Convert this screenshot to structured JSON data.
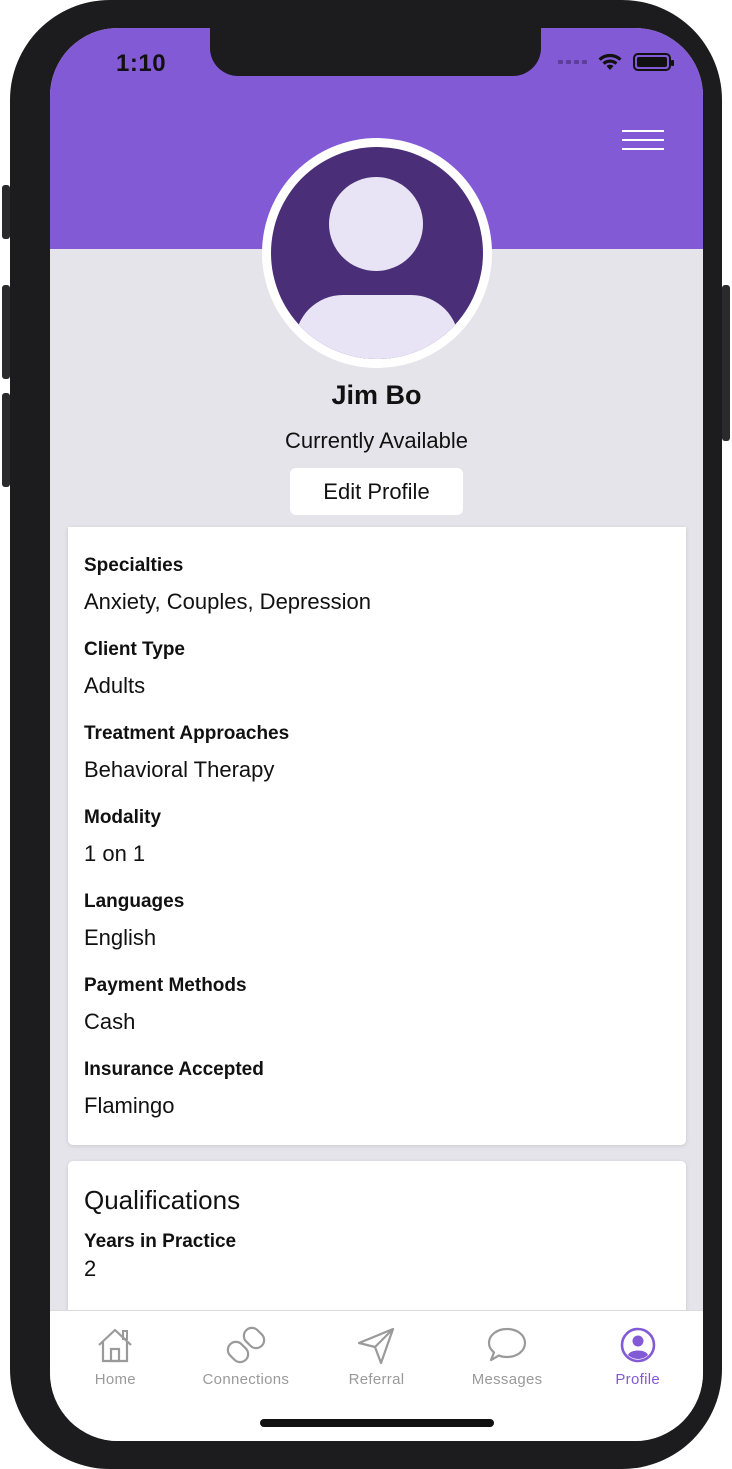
{
  "status_bar": {
    "time": "1:10"
  },
  "profile": {
    "name": "Jim Bo",
    "availability": "Currently Available",
    "edit_label": "Edit Profile"
  },
  "details": [
    {
      "label": "Specialties",
      "value": "Anxiety, Couples, Depression"
    },
    {
      "label": "Client Type",
      "value": "Adults"
    },
    {
      "label": "Treatment Approaches",
      "value": "Behavioral Therapy"
    },
    {
      "label": "Modality",
      "value": "1 on 1"
    },
    {
      "label": "Languages",
      "value": "English"
    },
    {
      "label": "Payment Methods",
      "value": "Cash"
    },
    {
      "label": "Insurance Accepted",
      "value": "Flamingo"
    }
  ],
  "qualifications": {
    "title": "Qualifications",
    "years_label": "Years in Practice",
    "years_value": "2"
  },
  "tabs": [
    {
      "label": "Home",
      "icon": "home-icon",
      "active": false
    },
    {
      "label": "Connections",
      "icon": "link-icon",
      "active": false
    },
    {
      "label": "Referral",
      "icon": "send-icon",
      "active": false
    },
    {
      "label": "Messages",
      "icon": "chat-bubble-icon",
      "active": false
    },
    {
      "label": "Profile",
      "icon": "user-circle-icon",
      "active": true
    }
  ],
  "colors": {
    "accent": "#835ad6",
    "avatar_bg": "#4a2f78",
    "screen_bg": "#e5e4ea",
    "tab_inactive": "#9a9a9a"
  }
}
